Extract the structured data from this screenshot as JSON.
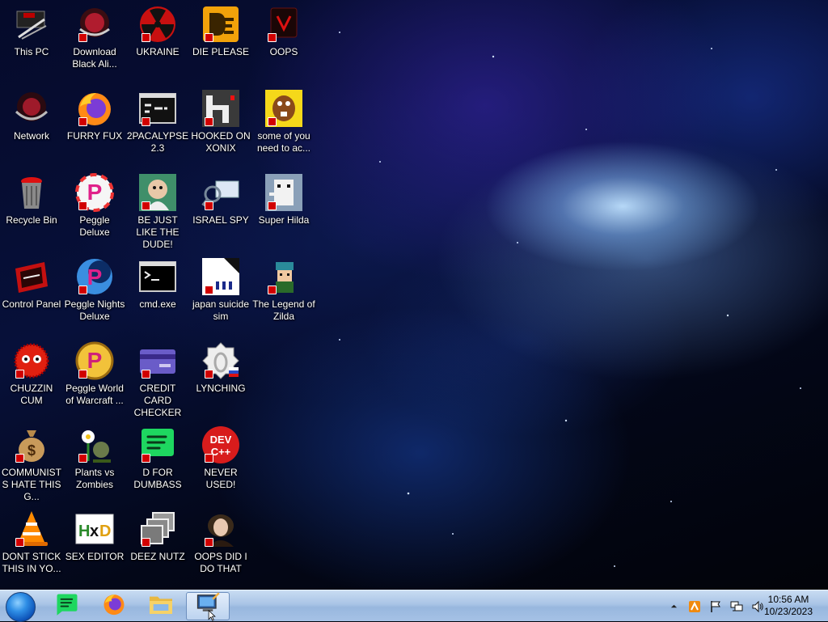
{
  "desktop": {
    "icons": [
      {
        "label": "This PC",
        "icon": "this-pc-icon"
      },
      {
        "label": "Download Black Ali...",
        "icon": "download-icon"
      },
      {
        "label": "UKRAINE",
        "icon": "radiation-icon"
      },
      {
        "label": "DIE PLEASE",
        "icon": "die-icon"
      },
      {
        "label": "OOPS",
        "icon": "oops-icon"
      },
      {
        "label": "Network",
        "icon": "network-icon"
      },
      {
        "label": "FURRY FUX",
        "icon": "firefox-icon"
      },
      {
        "label": "2PACALYPSE 2.3",
        "icon": "console-icon"
      },
      {
        "label": "HOOKED ON XONIX",
        "icon": "xonix-icon"
      },
      {
        "label": "some of you need to ac...",
        "icon": "beaver-icon"
      },
      {
        "label": "Recycle Bin",
        "icon": "recycle-bin-icon"
      },
      {
        "label": "Peggle Deluxe",
        "icon": "peggle-icon"
      },
      {
        "label": "BE JUST LIKE THE DUDE!",
        "icon": "dude-icon"
      },
      {
        "label": "ISRAEL SPY",
        "icon": "spy-icon"
      },
      {
        "label": "Super Hilda",
        "icon": "hilda-icon"
      },
      {
        "label": "Control Panel",
        "icon": "control-panel-icon"
      },
      {
        "label": "Peggle Nights Deluxe",
        "icon": "peggle-nights-icon"
      },
      {
        "label": "cmd.exe",
        "icon": "cmd-icon"
      },
      {
        "label": "japan suicide sim",
        "icon": "japan-sim-icon"
      },
      {
        "label": "The Legend of Zilda",
        "icon": "zilda-icon"
      },
      {
        "label": "CHUZZIN CUM",
        "icon": "chuzzle-icon"
      },
      {
        "label": "Peggle World of Warcraft ...",
        "icon": "peggle-wow-icon"
      },
      {
        "label": "CREDIT CARD CHECKER",
        "icon": "credit-card-icon"
      },
      {
        "label": "LYNCHING",
        "icon": "lynching-icon"
      },
      {
        "label": "COMMUNISTS HATE THIS G...",
        "icon": "money-bag-icon"
      },
      {
        "label": "Plants vs Zombies",
        "icon": "plants-icon"
      },
      {
        "label": "D FOR DUMBASS",
        "icon": "spotify-icon"
      },
      {
        "label": "NEVER USED!",
        "icon": "devcpp-icon"
      },
      {
        "label": "DONT STICK THIS IN YO...",
        "icon": "vlc-icon"
      },
      {
        "label": "SEX EDITOR",
        "icon": "hxd-icon"
      },
      {
        "label": "DEEZ NUTZ",
        "icon": "stacked-windows-icon"
      },
      {
        "label": "OOPS DID I DO THAT",
        "icon": "portrait-icon"
      }
    ],
    "devcpp_text": [
      "DEV",
      "C++"
    ]
  },
  "taskbar": {
    "pinned": [
      {
        "name": "spotify",
        "icon": "spotify-icon"
      },
      {
        "name": "firefox",
        "icon": "firefox-icon"
      },
      {
        "name": "file-explorer",
        "icon": "folder-icon"
      },
      {
        "name": "active-window",
        "icon": "remote-desktop-icon"
      }
    ],
    "clock": {
      "time": "10:56 AM",
      "date": "10/23/2023"
    }
  },
  "colors": {
    "badge": "#d10000",
    "taskbar": "#a9c4e6"
  }
}
